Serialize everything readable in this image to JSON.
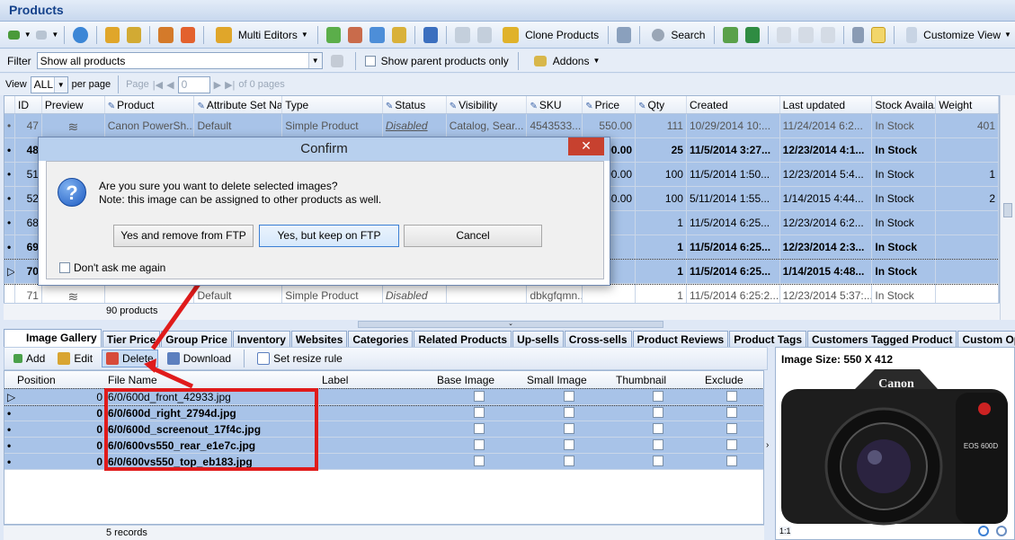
{
  "window": {
    "title": "Products"
  },
  "toolbar": {
    "multi_editors": "Multi Editors",
    "clone_products": "Clone Products",
    "search": "Search",
    "customize_view": "Customize View"
  },
  "filterbar": {
    "filter_label": "Filter",
    "filter_value": "Show all products",
    "show_parent_label": "Show parent products only",
    "addons_label": "Addons"
  },
  "pager": {
    "view_label": "View",
    "view_value": "ALL",
    "per_page_label": "per page",
    "page_label": "Page",
    "page_value": "0",
    "of_pages": "of 0 pages"
  },
  "products_grid": {
    "headers": [
      "ID",
      "Preview",
      "Product",
      "Attribute Set Na...",
      "Type",
      "Status",
      "Visibility",
      "SKU",
      "Price",
      "Qty",
      "Created",
      "Last updated",
      "Stock Availa...",
      "Weight"
    ],
    "rows": [
      {
        "id": "47",
        "product": "Canon PowerSh...",
        "attr": "Default",
        "type": "Simple Product",
        "status": "Disabled",
        "visibility": "Catalog, Sear...",
        "sku": "4543533...",
        "price": "550.00",
        "qty": "111",
        "created": "10/29/2014 10:...",
        "updated": "11/24/2014 6:2...",
        "stock": "In Stock",
        "weight": "401"
      },
      {
        "id": "48",
        "product": "",
        "attr": "",
        "type": "",
        "status": "",
        "visibility": "",
        "sku": "",
        "price": "00.00",
        "qty": "25",
        "created": "11/5/2014 3:27...",
        "updated": "12/23/2014 4:1...",
        "stock": "In Stock",
        "weight": ""
      },
      {
        "id": "51",
        "product": "",
        "attr": "",
        "type": "",
        "status": "",
        "visibility": "",
        "sku": "",
        "price": "00.00",
        "qty": "100",
        "created": "11/5/2014 1:50...",
        "updated": "12/23/2014 5:4...",
        "stock": "In Stock",
        "weight": "1"
      },
      {
        "id": "52",
        "product": "",
        "attr": "",
        "type": "",
        "status": "",
        "visibility": "",
        "sku": "",
        "price": "50.00",
        "qty": "100",
        "created": "5/11/2014 1:55...",
        "updated": "1/14/2015 4:44...",
        "stock": "In Stock",
        "weight": "2"
      },
      {
        "id": "68",
        "product": "",
        "attr": "",
        "type": "",
        "status": "",
        "visibility": "",
        "sku": "",
        "price": "",
        "qty": "1",
        "created": "11/5/2014 6:25...",
        "updated": "12/23/2014 6:2...",
        "stock": "In Stock",
        "weight": ""
      },
      {
        "id": "69",
        "product": "",
        "attr": "",
        "type": "",
        "status": "",
        "visibility": "",
        "sku": "",
        "price": "",
        "qty": "1",
        "created": "11/5/2014 6:25...",
        "updated": "12/23/2014 2:3...",
        "stock": "In Stock",
        "weight": ""
      },
      {
        "id": "70",
        "product": "",
        "attr": "",
        "type": "",
        "status": "",
        "visibility": "",
        "sku": "",
        "price": "",
        "qty": "1",
        "created": "11/5/2014 6:25...",
        "updated": "1/14/2015 4:48...",
        "stock": "In Stock",
        "weight": ""
      },
      {
        "id": "71",
        "product": "",
        "attr": "Default",
        "type": "Simple Product",
        "status": "Disabled",
        "visibility": "",
        "sku": "dbkgfqmn...",
        "price": "",
        "qty": "1",
        "created": "11/5/2014 6:25:2...",
        "updated": "12/23/2014 5:37:...",
        "stock": "In Stock",
        "weight": ""
      }
    ],
    "footer": "90 products"
  },
  "tabs": [
    "Image Gallery",
    "Tier Price",
    "Group Price",
    "Inventory",
    "Websites",
    "Categories",
    "Related Products",
    "Up-sells",
    "Cross-sells",
    "Product Reviews",
    "Product Tags",
    "Customers Tagged Product",
    "Custom Options"
  ],
  "image_toolbar": {
    "add": "Add",
    "edit": "Edit",
    "delete": "Delete",
    "download": "Download",
    "resize": "Set resize rule"
  },
  "image_grid": {
    "headers": [
      "Position",
      "File Name",
      "Label",
      "Base Image",
      "Small Image",
      "Thumbnail",
      "Exclude"
    ],
    "rows": [
      {
        "position": "0",
        "file": "6/0/600d_front_42933.jpg"
      },
      {
        "position": "0",
        "file": "6/0/600d_right_2794d.jpg"
      },
      {
        "position": "0",
        "file": "6/0/600d_screenout_17f4c.jpg"
      },
      {
        "position": "0",
        "file": "6/0/600vs550_rear_e1e7c.jpg"
      },
      {
        "position": "0",
        "file": "6/0/600vs550_top_eb183.jpg"
      }
    ],
    "footer": "5 records"
  },
  "image_panel": {
    "size_label": "Image Size: 550 X 412",
    "brand": "Canon",
    "model": "EOS 600D",
    "zoom": "1:1"
  },
  "dialog": {
    "title": "Confirm",
    "close": "✕",
    "line1": "Are you sure you want to delete selected images?",
    "line2": "Note: this image can be assigned to other products as well.",
    "btn_remove": "Yes and remove from FTP",
    "btn_keep": "Yes, but keep on FTP",
    "btn_cancel": "Cancel",
    "dont_ask": "Don't ask me again"
  },
  "colors": {
    "selection": "#a8c3e8",
    "annotation": "#e01b1b",
    "dialog_title": "#b8d0ee"
  }
}
